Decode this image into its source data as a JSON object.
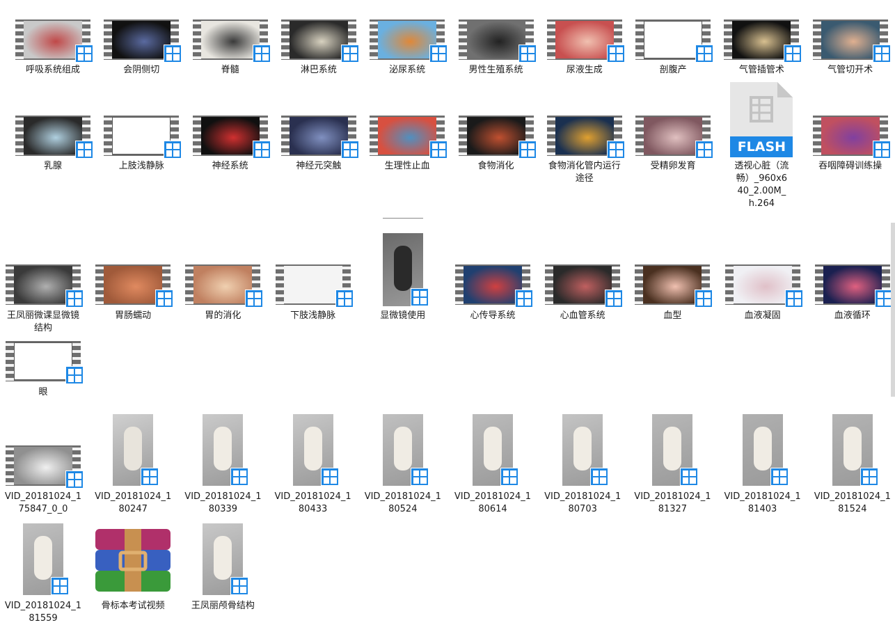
{
  "items": [
    {
      "label": "呼吸系统组成",
      "kind": "film",
      "bg": "#c9c9c9",
      "accent": "#c04848"
    },
    {
      "label": "会阴侧切",
      "kind": "film",
      "bg": "#111111",
      "accent": "#5a6aa0"
    },
    {
      "label": "脊髓",
      "kind": "film",
      "bg": "#e8e6e0",
      "accent": "#3a3a3a"
    },
    {
      "label": "淋巴系统",
      "kind": "film",
      "bg": "#2a2a2a",
      "accent": "#d8d2c0"
    },
    {
      "label": "泌尿系统",
      "kind": "film",
      "bg": "#6ab0e0",
      "accent": "#e08838"
    },
    {
      "label": "男性生殖系统",
      "kind": "film",
      "bg": "#707070",
      "accent": "#222222"
    },
    {
      "label": "尿液生成",
      "kind": "film",
      "bg": "#c85050",
      "accent": "#f0c0b0"
    },
    {
      "label": "剖腹产",
      "kind": "film",
      "bg": "#ffffff",
      "accent": "#ffffff"
    },
    {
      "label": "气管插管术",
      "kind": "film",
      "bg": "#111111",
      "accent": "#d8c090"
    },
    {
      "label": "气管切开术",
      "kind": "film",
      "bg": "#3a5a70",
      "accent": "#e0b090"
    },
    {
      "label": "乳腺",
      "kind": "film",
      "bg": "#2a2a2a",
      "accent": "#b0d0e0"
    },
    {
      "label": "上肢浅静脉",
      "kind": "film",
      "bg": "#ffffff",
      "accent": "#ffffff"
    },
    {
      "label": "神经系统",
      "kind": "film",
      "bg": "#101010",
      "accent": "#d03030"
    },
    {
      "label": "神经元突触",
      "kind": "film",
      "bg": "#2a3050",
      "accent": "#8090c0"
    },
    {
      "label": "生理性止血",
      "kind": "film",
      "bg": "#d85040",
      "accent": "#5090c0"
    },
    {
      "label": "食物消化",
      "kind": "film",
      "bg": "#1a1a1a",
      "accent": "#c05030"
    },
    {
      "label": "食物消化管内运行途径",
      "kind": "film",
      "bg": "#1a3050",
      "accent": "#e0a030"
    },
    {
      "label": "受精卵发育",
      "kind": "film",
      "bg": "#805860",
      "accent": "#e0c0c0"
    },
    {
      "label": "透视心脏（流畅）_960x640_2.00M_h.264",
      "kind": "flash",
      "bg": "#e8e8e8",
      "accent": "#1e88e5"
    },
    {
      "label": "吞咽障碍训练操",
      "kind": "film",
      "bg": "#c05060",
      "accent": "#8040a0"
    },
    {
      "label": "王凤丽微课显微镜结构",
      "kind": "film",
      "bg": "#3a3a3a",
      "accent": "#b0b0b0"
    },
    {
      "label": "胃肠蠕动",
      "kind": "film",
      "bg": "#a05a3a",
      "accent": "#e08a60"
    },
    {
      "label": "胃的消化",
      "kind": "film",
      "bg": "#c08060",
      "accent": "#f0d0b0"
    },
    {
      "label": "下肢浅静脉",
      "kind": "film",
      "bg": "#f4f4f4",
      "accent": "#f4f4f4"
    },
    {
      "label": "显微镜使用",
      "kind": "portrait",
      "bg": "#6a6a6a",
      "accent": "#2a2a2a"
    },
    {
      "label": "心传导系统",
      "kind": "film",
      "bg": "#204070",
      "accent": "#d04040"
    },
    {
      "label": "心血管系统",
      "kind": "film",
      "bg": "#2a2a2a",
      "accent": "#c06060"
    },
    {
      "label": "血型",
      "kind": "film",
      "bg": "#4a3020",
      "accent": "#f0c0b0"
    },
    {
      "label": "血液凝固",
      "kind": "film",
      "bg": "#f0f0f4",
      "accent": "#e0c0c8"
    },
    {
      "label": "血液循环",
      "kind": "film",
      "bg": "#1a2050",
      "accent": "#e06080"
    },
    {
      "label": "眼",
      "kind": "film",
      "bg": "#ffffff",
      "accent": "#ffffff"
    },
    {
      "label": "VID_20181024_175847_0_0",
      "kind": "film",
      "bg": "#909090",
      "accent": "#f0f0f0"
    },
    {
      "label": "VID_20181024_180247",
      "kind": "portrait",
      "bg": "#d0d0d0",
      "accent": "#e8e4dc"
    },
    {
      "label": "VID_20181024_180339",
      "kind": "portrait",
      "bg": "#cacaca",
      "accent": "#f0ece4"
    },
    {
      "label": "VID_20181024_180433",
      "kind": "portrait",
      "bg": "#c8c8c8",
      "accent": "#f0ece4"
    },
    {
      "label": "VID_20181024_180524",
      "kind": "portrait",
      "bg": "#c0c0c0",
      "accent": "#f0ece4"
    },
    {
      "label": "VID_20181024_180614",
      "kind": "portrait",
      "bg": "#bcbcbc",
      "accent": "#f0ece4"
    },
    {
      "label": "VID_20181024_180703",
      "kind": "portrait",
      "bg": "#c4c4c4",
      "accent": "#f0ece4"
    },
    {
      "label": "VID_20181024_181327",
      "kind": "portrait",
      "bg": "#b8b8b8",
      "accent": "#f0ece4"
    },
    {
      "label": "VID_20181024_181403",
      "kind": "portrait",
      "bg": "#b0b0b0",
      "accent": "#f0ece4"
    },
    {
      "label": "VID_20181024_181524",
      "kind": "portrait",
      "bg": "#b4b4b4",
      "accent": "#f0ece4"
    },
    {
      "label": "VID_20181024_181559",
      "kind": "portrait",
      "bg": "#c0c0c0",
      "accent": "#f0ece4"
    },
    {
      "label": "骨标本考试视频",
      "kind": "rar",
      "bg": "#ffffff",
      "accent": "#ffffff"
    },
    {
      "label": "王凤丽颅骨结构",
      "kind": "portrait",
      "bg": "#c8c8c8",
      "accent": "#f0ece4"
    }
  ],
  "flash_badge": "FLASH"
}
